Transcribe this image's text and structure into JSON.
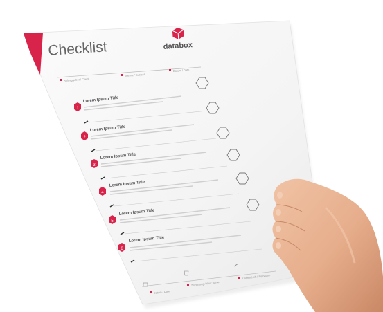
{
  "document": {
    "title": "Checklist",
    "brand": "databox",
    "header_fields": [
      "Auftraggeber / Client",
      "Thema / Subject",
      "Datum / Date"
    ],
    "items": [
      {
        "number": "1",
        "title": "Lorem Ipsum Title"
      },
      {
        "number": "2",
        "title": "Lorem Ipsum Title"
      },
      {
        "number": "3",
        "title": "Lorem Ipsum Title"
      },
      {
        "number": "4",
        "title": "Lorem Ipsum Title"
      },
      {
        "number": "5",
        "title": "Lorem Ipsum Title"
      },
      {
        "number": "6",
        "title": "Lorem Ipsum Title"
      }
    ],
    "footer_fields": [
      "Datum / Date",
      "Zeichnung / Your name",
      "Unterschrift / Signature"
    ]
  },
  "colors": {
    "accent": "#d8234a",
    "paper": "#f7f7f7",
    "text_dark": "#4a4a4a",
    "text_light": "#9a9a9a",
    "skin": "#e9b595"
  },
  "icons": [
    "databox-logo-icon",
    "hexagon-checkbox-icon",
    "pencil-icon"
  ]
}
